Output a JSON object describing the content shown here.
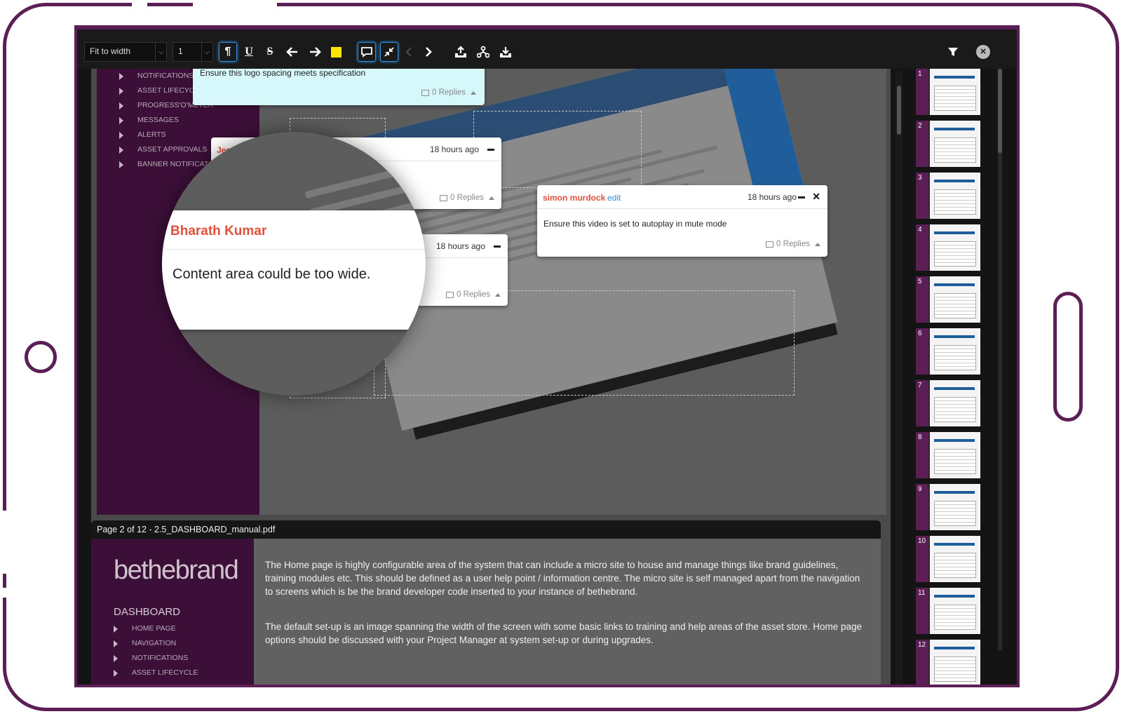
{
  "toolbar": {
    "zoom_value": "Fit to width",
    "page_value": "1",
    "buttons": [
      "paragraph-mark",
      "underline",
      "strikethrough",
      "arrow-left",
      "arrow-right",
      "highlight-color",
      "comment",
      "collapse",
      "chevron-left",
      "chevron-right",
      "upload",
      "share",
      "download"
    ],
    "highlight_color": "#ffe600"
  },
  "page1": {
    "nav_items": [
      "NOTIFICATIONS",
      "ASSET LIFECYCLE",
      "PROGRESS'O'METER",
      "MESSAGES",
      "ALERTS",
      "ASSET APPROVALS",
      "BANNER NOTIFICATION"
    ]
  },
  "comments": {
    "top": {
      "body": "Ensure this logo spacing meets specification",
      "replies": "0 Replies"
    },
    "jes": {
      "author": "Jes",
      "time": "18 hours ago",
      "replies": "0 Replies"
    },
    "third": {
      "time": "18 hours ago",
      "replies": "0 Replies"
    },
    "simon": {
      "author": "simon murdock",
      "edit": "edit",
      "time": "18 hours ago",
      "body": "Ensure this video is set to autoplay in mute mode",
      "replies": "0 Replies"
    }
  },
  "magnifier": {
    "author": "Bharath Kumar",
    "body": "Content area could be too wide."
  },
  "page2": {
    "label": "Page 2 of 12 - 2.5_DASHBOARD_manual.pdf",
    "brand": "bethebrand",
    "section_title": "DASHBOARD",
    "nav_items": [
      "HOME PAGE",
      "NAVIGATION",
      "NOTIFICATIONS",
      "ASSET LIFECYCLE"
    ],
    "paragraph1": "The Home page is highly configurable area of the system that can include a micro site to house and manage things like brand guidelines, training modules etc. This should be defined as a user help point / information centre. The micro site is self managed apart from the navigation to screens which is be the brand developer code inserted to your instance of bethebrand.",
    "paragraph2": "The default set-up is an image spanning the width of the screen with some basic links to training and help areas of the asset store. Home page options should be discussed with your Project Manager at system set-up or during upgrades."
  },
  "thumbnails": [
    "1",
    "2",
    "3",
    "4",
    "5",
    "6",
    "7",
    "8",
    "9",
    "10",
    "11",
    "12"
  ],
  "colors": {
    "frame": "#5b1f55",
    "author": "#e0503c",
    "link": "#2f8fd8",
    "accent": "#2a8fe0"
  }
}
